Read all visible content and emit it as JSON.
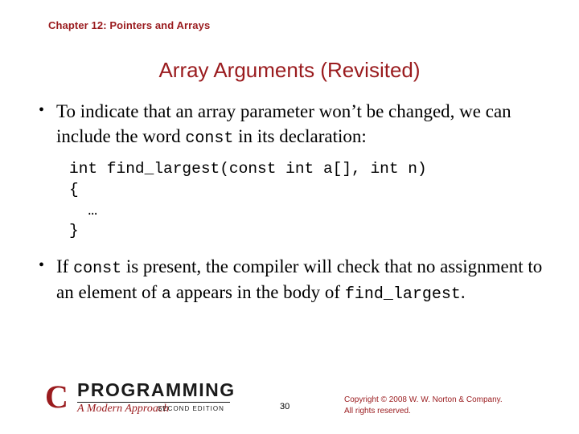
{
  "header": {
    "chapter": "Chapter 12: Pointers and Arrays"
  },
  "title": "Array Arguments (Revisited)",
  "bullets": {
    "first": {
      "marker": "•",
      "part1": "To indicate that an array parameter won’t be changed, we can include the word ",
      "code1": "const",
      "part2": " in its declaration:"
    },
    "second": {
      "marker": "•",
      "part1": "If ",
      "code1": "const",
      "part2": " is present, the compiler will check that no assignment to an element of ",
      "code2": "a",
      "part3": " appears in the body of ",
      "code3": "find_largest",
      "part4": "."
    }
  },
  "code_block": "int find_largest(const int a[], int n)\n{\n  …\n}",
  "footer": {
    "logo_c": "C",
    "logo_programming": "PROGRAMMING",
    "logo_subtitle": "A Modern Approach",
    "logo_edition": "SECOND EDITION",
    "page_number": "30",
    "copyright_line1": "Copyright © 2008 W. W. Norton & Company.",
    "copyright_line2": "All rights reserved."
  }
}
